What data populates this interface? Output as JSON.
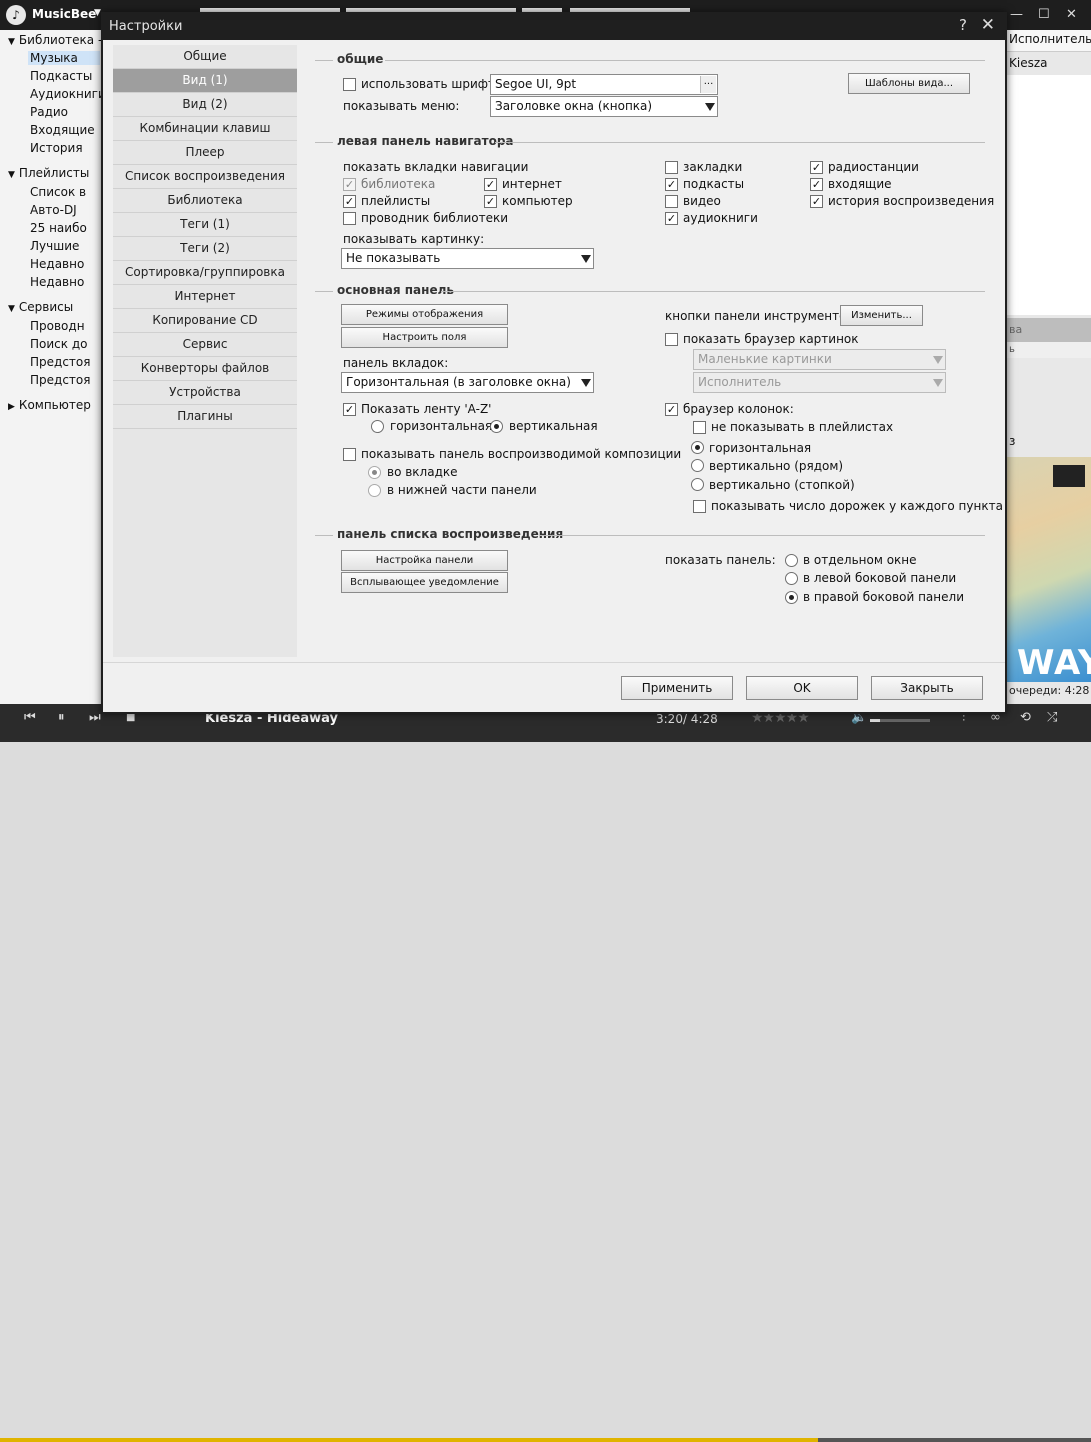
{
  "app": {
    "name": "MusicBee",
    "library_header": "Библиотека -",
    "library_items": [
      "Музыка",
      "Подкасты",
      "Аудиокниги",
      "Радио",
      "Входящие",
      "История"
    ],
    "playlists_header": "Плейлисты",
    "playlist_items": [
      "Список в",
      "Авто-DJ",
      "25 наибо",
      "Лучшие",
      "Недавно",
      "Недавно"
    ],
    "services_header": "Сервисы",
    "service_items": [
      "Проводн",
      "Поиск до",
      "Предстоя",
      "Предстоя"
    ],
    "computer_header": "Компьютер",
    "right_column_header": "Исполнитель",
    "right_first_row": "Kiesza",
    "right_tab_label": "ва",
    "right_tab_sub": "ь",
    "right_side_glyph": "з",
    "album_text": "WAY",
    "queue_text": "очереди: 4:28",
    "now_playing": "Kiesza - Hideaway",
    "time": "3:20/ 4:28",
    "progress_fraction": 0.75,
    "rating": "★★★★★",
    "stars_empty_color": "#666666",
    "progress_color": "#e0b400"
  },
  "dialog": {
    "title": "Настройки",
    "help_glyph": "?",
    "close_glyph": "✕",
    "nav": [
      "Общие",
      "Вид (1)",
      "Вид (2)",
      "Комбинации клавиш",
      "Плеер",
      "Список воспроизведения",
      "Библиотека",
      "Теги (1)",
      "Теги (2)",
      "Сортировка/группировка",
      "Интернет",
      "Копирование CD",
      "Сервис",
      "Конверторы файлов",
      "Устройства",
      "Плагины"
    ],
    "active_nav": "Вид (1)",
    "general": {
      "section": "общие",
      "use_font_label": "использовать шрифт:",
      "use_font_checked": false,
      "font_value": "Segoe UI, 9pt",
      "font_browse": "...",
      "show_menu_label": "показывать меню:",
      "show_menu_value": "Заголовке окна (кнопка)",
      "templates_button": "Шаблоны вида..."
    },
    "nav_panel": {
      "section": "левая панель навигатора",
      "tabs_label": "показать вкладки навигации",
      "library": {
        "label": "библиотека",
        "checked": true,
        "disabled": true
      },
      "internet": {
        "label": "интернет",
        "checked": true
      },
      "playlists": {
        "label": "плейлисты",
        "checked": true
      },
      "computer": {
        "label": "компьютер",
        "checked": true
      },
      "explorer": {
        "label": "проводник библиотеки",
        "checked": false
      },
      "bookmarks": {
        "label": "закладки",
        "checked": false
      },
      "podcasts": {
        "label": "подкасты",
        "checked": true
      },
      "video": {
        "label": "видео",
        "checked": false
      },
      "audiobooks": {
        "label": "аудиокниги",
        "checked": true
      },
      "radio": {
        "label": "радиостанции",
        "checked": true
      },
      "inbox": {
        "label": "входящие",
        "checked": true
      },
      "history": {
        "label": "история воспроизведения",
        "checked": true
      },
      "picture_label": "показывать картинку:",
      "picture_value": "Не показывать"
    },
    "main_panel": {
      "section": "основная панель",
      "display_modes_button": "Режимы отображения",
      "configure_fields_button": "Настроить поля",
      "tabs_panel_label": "панель вкладок:",
      "tabs_panel_value": "Горизонтальная (в заголовке окна)",
      "az_label": "Показать ленту 'A-Z'",
      "az_checked": true,
      "horizontal": "горизонтальная",
      "vertical": "вертикальная",
      "az_orientation": "vertical",
      "now_playing_label": "показывать панель воспроизводимой композиции",
      "now_playing_checked": false,
      "in_tab": "во вкладке",
      "in_bottom": "в нижней части панели",
      "toolbar_label": "кнопки панели инструментов:",
      "toolbar_button": "Изменить...",
      "art_browser_label": "показать браузер картинок",
      "art_browser_checked": false,
      "art_size_value": "Маленькие картинки",
      "art_field_value": "Исполнитель",
      "column_browser_label": "браузер колонок:",
      "column_browser_checked": true,
      "hide_in_playlists": "не показывать в плейлистах",
      "hide_in_playlists_checked": false,
      "col_horizontal": "горизонтальная",
      "col_vertical_side": "вертикально (рядом)",
      "col_vertical_stack": "вертикально (стопкой)",
      "col_orientation": "horizontal",
      "show_track_count": "показывать число дорожек у каждого пункта",
      "show_track_count_checked": false
    },
    "playlist_panel": {
      "section": "панель списка воспроизведения",
      "configure_button": "Настройка панели",
      "popup_button": "Всплывающее уведомление",
      "show_panel_label": "показать панель:",
      "opt_window": "в отдельном окне",
      "opt_left": "в левой боковой панели",
      "opt_right": "в правой боковой панели",
      "selected": "right"
    },
    "footer": {
      "apply": "Применить",
      "ok": "OK",
      "cancel": "Закрыть"
    }
  }
}
